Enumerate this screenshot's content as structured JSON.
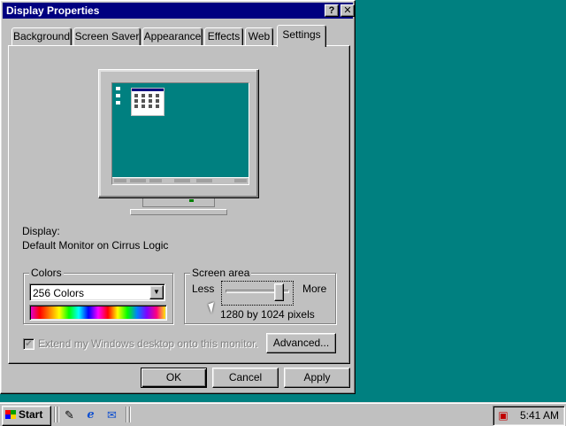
{
  "window": {
    "title": "Display Properties",
    "help_button": "?",
    "close_button": "✕"
  },
  "tabs": [
    {
      "label": "Background",
      "active": false
    },
    {
      "label": "Screen Saver",
      "active": false
    },
    {
      "label": "Appearance",
      "active": false
    },
    {
      "label": "Effects",
      "active": false
    },
    {
      "label": "Web",
      "active": false
    },
    {
      "label": "Settings",
      "active": true
    }
  ],
  "settings": {
    "display_label": "Display:",
    "display_value": "Default Monitor on Cirrus Logic",
    "colors": {
      "group_title": "Colors",
      "selected": "256 Colors"
    },
    "screen_area": {
      "group_title": "Screen area",
      "less_label": "Less",
      "more_label": "More",
      "resolution_text": "1280 by 1024 pixels",
      "slider_level": 0.9
    },
    "extend_desktop": {
      "label": "Extend my Windows desktop onto this monitor.",
      "checked": true,
      "enabled": false
    },
    "advanced_button": "Advanced..."
  },
  "buttons": {
    "ok": "OK",
    "cancel": "Cancel",
    "apply": "Apply"
  },
  "taskbar": {
    "start_label": "Start",
    "clock": "5:41 AM",
    "quick_launch_icons": [
      "show-desktop-icon",
      "internet-explorer-icon",
      "outlook-express-icon"
    ],
    "tray_icons": [
      "display-settings-tray-icon"
    ]
  },
  "colors": {
    "desktop": "#008080",
    "title_bar": "#000080",
    "face": "#c0c0c0"
  }
}
